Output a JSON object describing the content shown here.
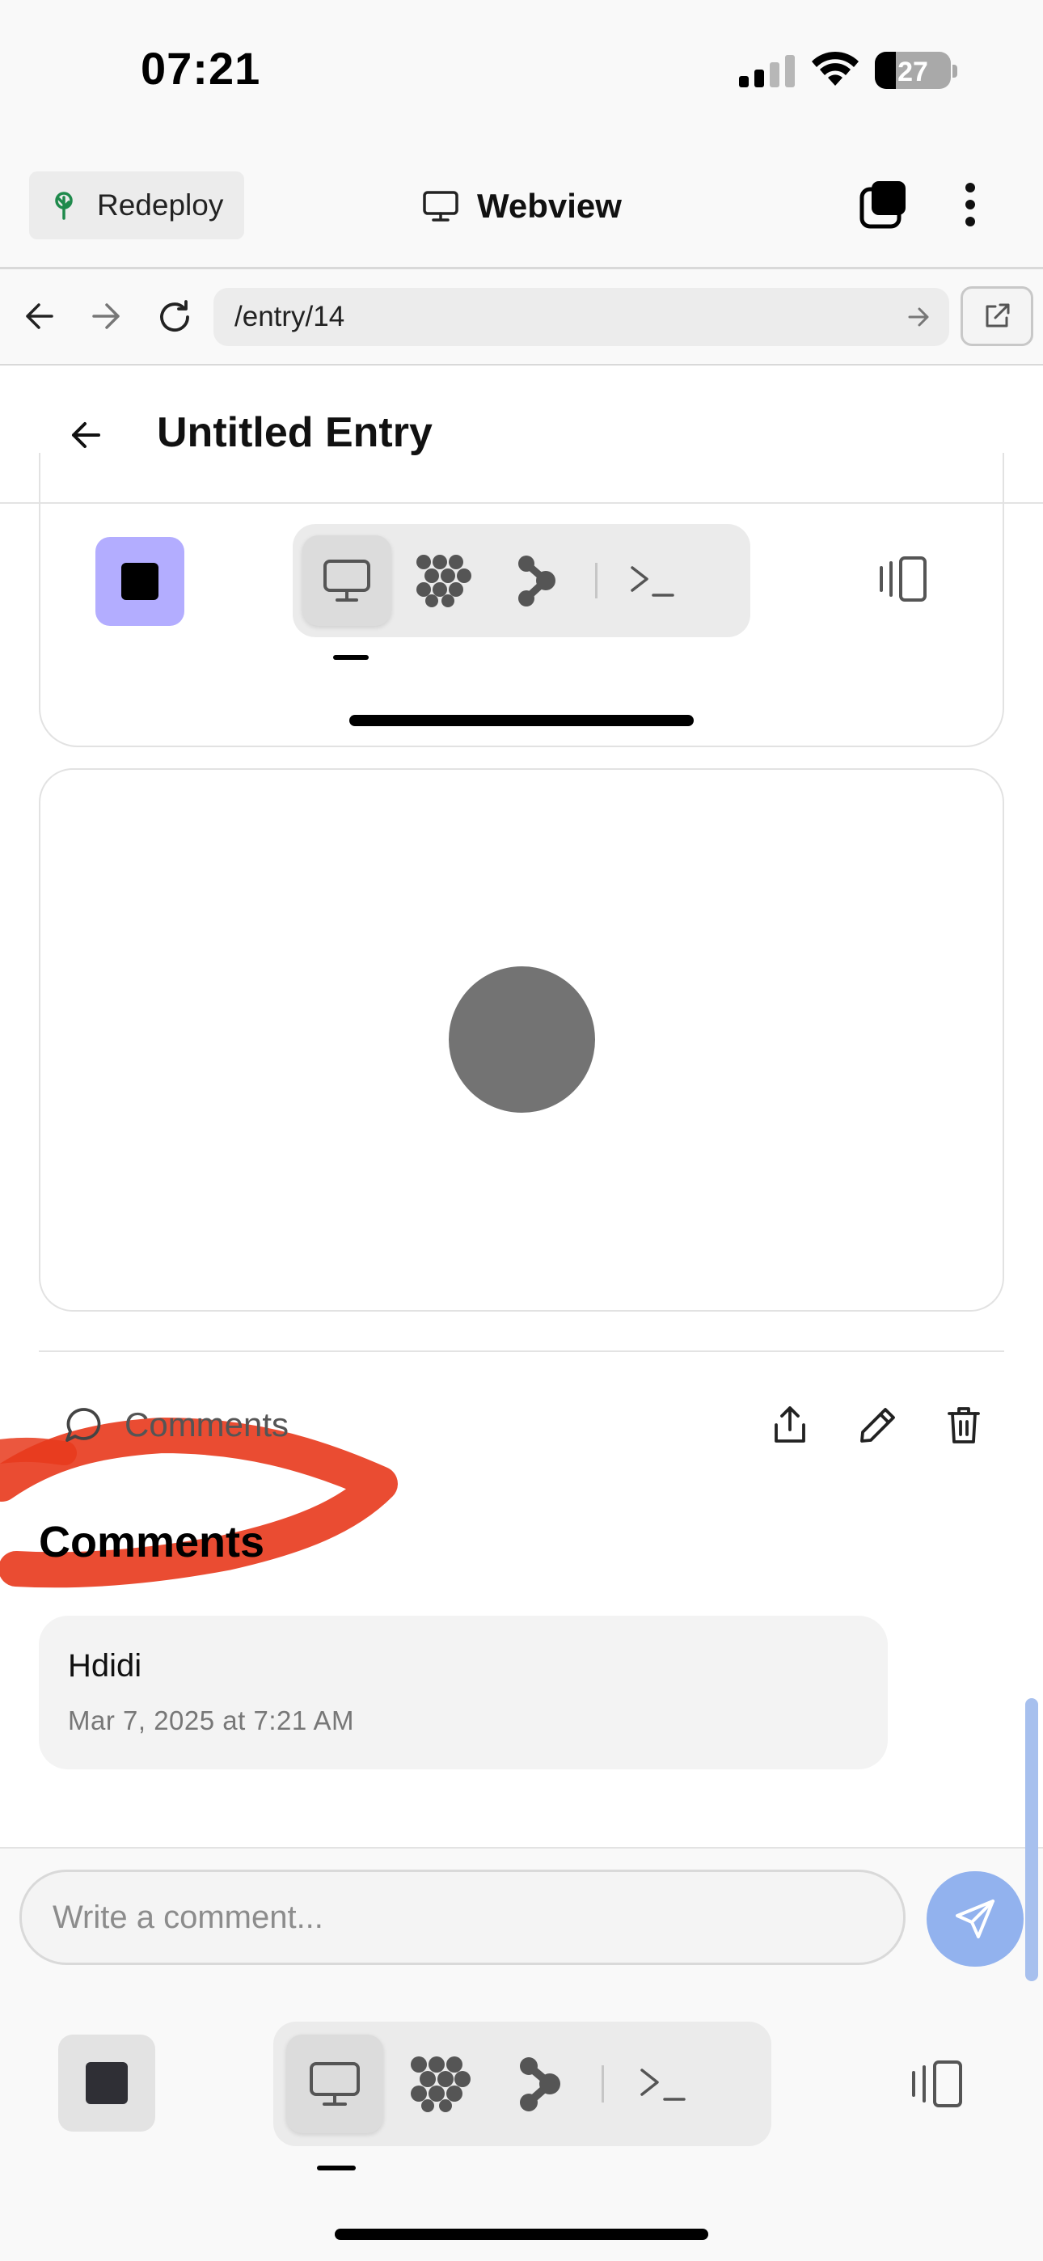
{
  "status_bar": {
    "time": "07:21",
    "battery": "27"
  },
  "app_header": {
    "redeploy_label": "Redeploy",
    "title": "Webview"
  },
  "browser": {
    "url": "/entry/14"
  },
  "entry": {
    "title": "Untitled Entry"
  },
  "actions": {
    "comments_toggle_label": "Comments"
  },
  "comments": {
    "heading": "Comments",
    "items": [
      {
        "text": "Hdidi",
        "timestamp": "Mar 7, 2025 at 7:21 AM"
      }
    ],
    "input_placeholder": "Write a comment..."
  },
  "icons": {
    "status": [
      "signal-icon",
      "wifi-icon",
      "battery-icon"
    ],
    "header": [
      "tree-icon",
      "monitor-icon",
      "tabs-icon",
      "more-vertical-icon"
    ],
    "browser": [
      "back-arrow-icon",
      "forward-arrow-icon",
      "reload-icon",
      "go-arrow-icon",
      "external-link-icon"
    ],
    "toolbar": [
      "desktop-icon",
      "dots-grid-icon",
      "branch-icon",
      "terminal-icon",
      "split-view-icon"
    ],
    "entry_actions": [
      "chat-bubble-icon",
      "share-icon",
      "pencil-icon",
      "trash-icon"
    ],
    "composer": [
      "send-icon"
    ]
  },
  "colors": {
    "accent_purple": "#b3adff",
    "send_button": "#92b2ee",
    "annotation": "#e8391c",
    "placeholder_circle": "#737373"
  }
}
